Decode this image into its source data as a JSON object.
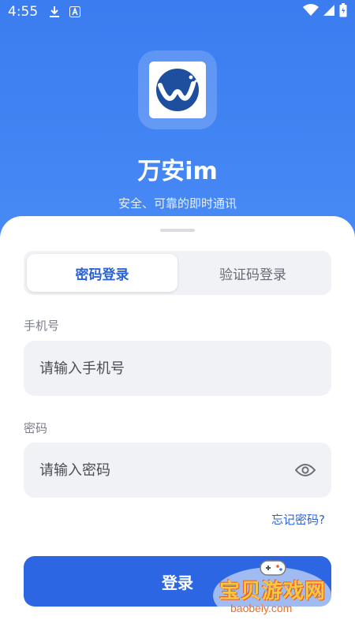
{
  "status_bar": {
    "time": "4:55",
    "icons": [
      "download-icon",
      "a-notification-icon",
      "wifi-icon",
      "battery-icon"
    ]
  },
  "app": {
    "title": "万安im",
    "subtitle": "安全、可靠的即时通讯"
  },
  "tabs": [
    {
      "label": "密码登录",
      "active": true
    },
    {
      "label": "验证码登录",
      "active": false
    }
  ],
  "form": {
    "phone_label": "手机号",
    "phone_placeholder": "请输入手机号",
    "password_label": "密码",
    "password_placeholder": "请输入密码",
    "forgot_label": "忘记密码?",
    "login_label": "登录"
  },
  "watermark": {
    "title": "宝贝游戏网",
    "url": "baobeiy.com"
  },
  "colors": {
    "accent": "#2d66e3",
    "header_gradient_top": "#3b7cf0",
    "field_bg": "#f1f2f6"
  }
}
